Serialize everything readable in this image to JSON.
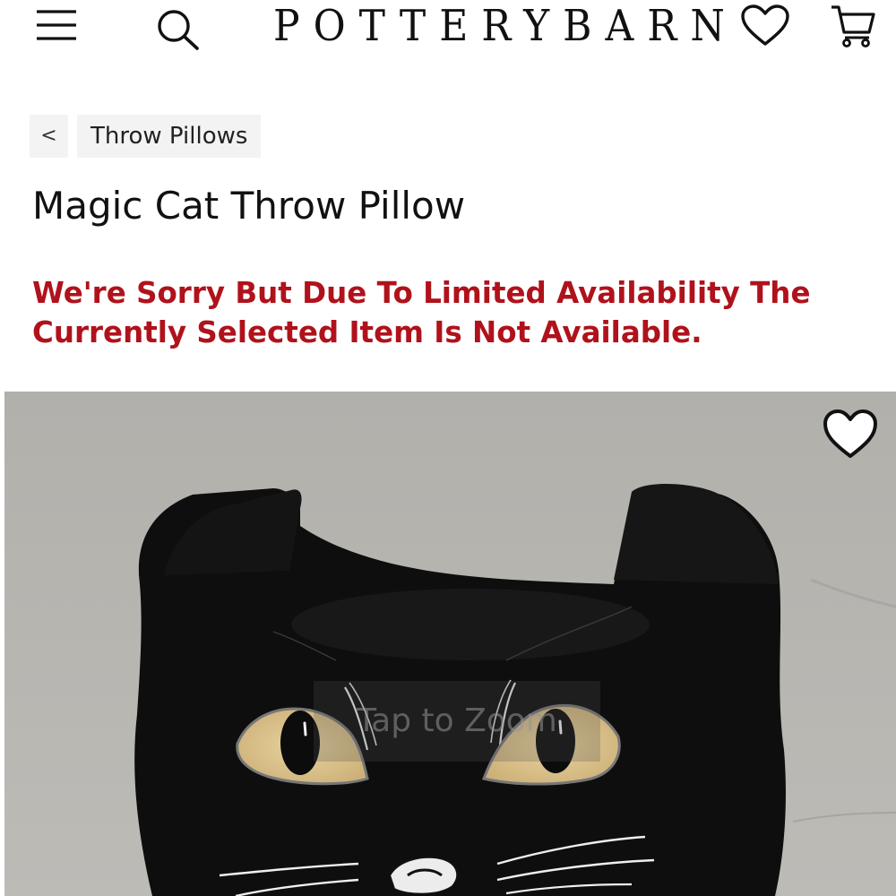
{
  "header": {
    "logo": "POTTERYBARN",
    "menu_icon": "hamburger-menu-icon",
    "search_icon": "search-icon",
    "wishlist_icon": "heart-icon",
    "cart_icon": "shopping-cart-icon"
  },
  "breadcrumb": {
    "back": "<",
    "category": "Throw Pillows"
  },
  "product": {
    "title": "Magic Cat Throw Pillow",
    "availability_message": "We're Sorry But Due To Limited Availability The Currently Selected Item Is Not Available.",
    "zoom_hint": "Tap to Zoom",
    "favorite_icon": "heart-outline-icon"
  },
  "colors": {
    "error_text": "#b0121b",
    "breadcrumb_bg": "#f3f3f3",
    "text": "#111111"
  }
}
